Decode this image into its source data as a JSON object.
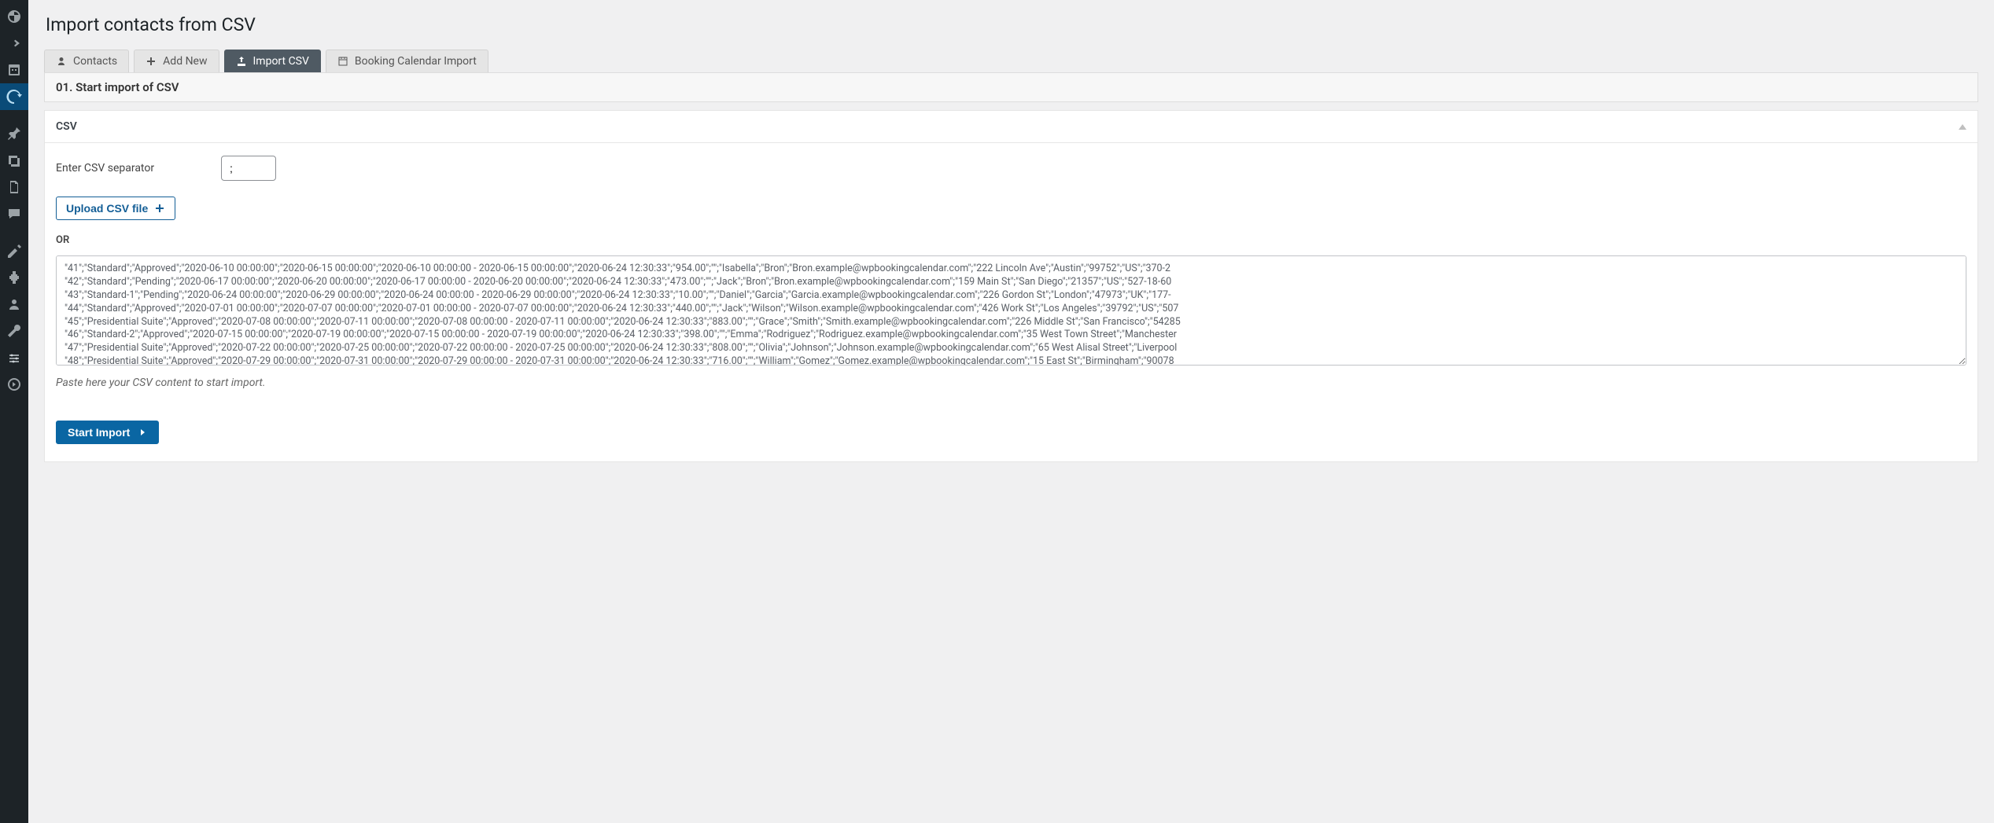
{
  "page_title": "Import contacts from CSV",
  "tabs": [
    {
      "label": "Contacts",
      "icon": "person-icon"
    },
    {
      "label": "Add New",
      "icon": "plus-icon"
    },
    {
      "label": "Import CSV",
      "icon": "import-icon"
    },
    {
      "label": "Booking Calendar Import",
      "icon": "calendar-icon"
    }
  ],
  "section_title": "01. Start import of CSV",
  "panel_title": "CSV",
  "separator": {
    "label": "Enter CSV separator",
    "value": ";"
  },
  "upload_label": "Upload CSV file",
  "or_label": "OR",
  "csv_content": "\"41\";\"Standard\";\"Approved\";\"2020-06-10 00:00:00\";\"2020-06-15 00:00:00\";\"2020-06-10 00:00:00 - 2020-06-15 00:00:00\";\"2020-06-24 12:30:33\";\"954.00\";\"\";\"Isabella\";\"Bron\";\"Bron.example@wpbookingcalendar.com\";\"222 Lincoln Ave\";\"Austin\";\"99752\";\"US\";\"370-2\n\"42\";\"Standard\";\"Pending\";\"2020-06-17 00:00:00\";\"2020-06-20 00:00:00\";\"2020-06-17 00:00:00 - 2020-06-20 00:00:00\";\"2020-06-24 12:30:33\";\"473.00\";\"\";\"Jack\";\"Bron\";\"Bron.example@wpbookingcalendar.com\";\"159 Main St\";\"San Diego\";\"21357\";\"US\";\"527-18-60\n\"43\";\"Standard-1\";\"Pending\";\"2020-06-24 00:00:00\";\"2020-06-29 00:00:00\";\"2020-06-24 00:00:00 - 2020-06-29 00:00:00\";\"2020-06-24 12:30:33\";\"10.00\";\"\";\"Daniel\";\"Garcia\";\"Garcia.example@wpbookingcalendar.com\";\"226 Gordon St\";\"London\";\"47973\";\"UK\";\"177-\n\"44\";\"Standard\";\"Approved\";\"2020-07-01 00:00:00\";\"2020-07-07 00:00:00\";\"2020-07-01 00:00:00 - 2020-07-07 00:00:00\";\"2020-06-24 12:30:33\";\"440.00\";\"\";\"Jack\";\"Wilson\";\"Wilson.example@wpbookingcalendar.com\";\"426 Work St\";\"Los Angeles\";\"39792\";\"US\";\"507\n\"45\";\"Presidential Suite\";\"Approved\";\"2020-07-08 00:00:00\";\"2020-07-11 00:00:00\";\"2020-07-08 00:00:00 - 2020-07-11 00:00:00\";\"2020-06-24 12:30:33\";\"883.00\";\"\";\"Grace\";\"Smith\";\"Smith.example@wpbookingcalendar.com\";\"226 Middle St\";\"San Francisco\";\"54285\n\"46\";\"Standard-2\";\"Approved\";\"2020-07-15 00:00:00\";\"2020-07-19 00:00:00\";\"2020-07-15 00:00:00 - 2020-07-19 00:00:00\";\"2020-06-24 12:30:33\";\"398.00\";\"\";\"Emma\";\"Rodriguez\";\"Rodriguez.example@wpbookingcalendar.com\";\"35 West Town Street\";\"Manchester\n\"47\";\"Presidential Suite\";\"Approved\";\"2020-07-22 00:00:00\";\"2020-07-25 00:00:00\";\"2020-07-22 00:00:00 - 2020-07-25 00:00:00\";\"2020-06-24 12:30:33\";\"808.00\";\"\";\"Olivia\";\"Johnson\";\"Johnson.example@wpbookingcalendar.com\";\"65 West Alisal Street\";\"Liverpool\n\"48\";\"Presidential Suite\";\"Approved\";\"2020-07-29 00:00:00\";\"2020-07-31 00:00:00\";\"2020-07-29 00:00:00 - 2020-07-31 00:00:00\";\"2020-06-24 12:30:33\";\"716.00\";\"\";\"William\";\"Gomez\";\"Gomez.example@wpbookingcalendar.com\";\"15 East St\";\"Birmingham\";\"90078",
  "hint": "Paste here your CSV content to start import.",
  "start_label": "Start Import"
}
